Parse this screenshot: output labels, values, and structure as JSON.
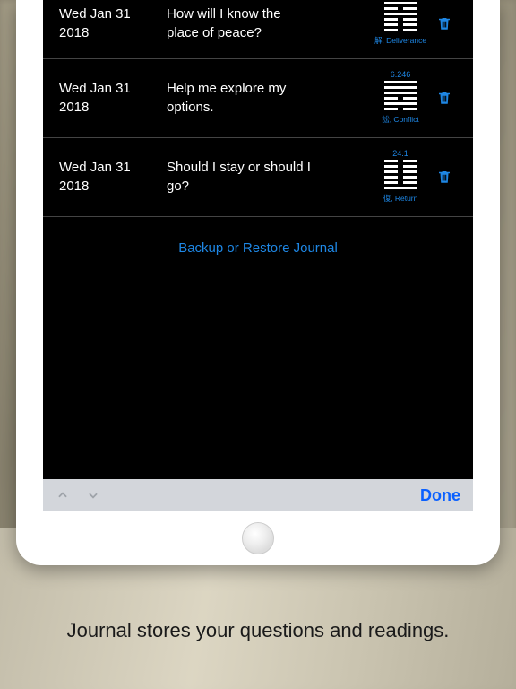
{
  "entries": [
    {
      "date_l1": "Wed Jan 31",
      "date_l2": "2018",
      "question_l1": "How will I know the",
      "question_l2": "place of peace?",
      "hex_num": "",
      "hex_name": "解, Deliverance",
      "pattern": [
        1,
        0,
        1,
        0,
        0,
        0
      ]
    },
    {
      "date_l1": "Wed Jan 31",
      "date_l2": "2018",
      "question_l1": "Help me explore my",
      "question_l2": "options.",
      "hex_num": "6.246",
      "hex_name": "訟, Conflict",
      "pattern": [
        1,
        1,
        1,
        0,
        1,
        0
      ]
    },
    {
      "date_l1": "Wed Jan 31",
      "date_l2": "2018",
      "question_l1": "Should I stay or should I",
      "question_l2": "go?",
      "hex_num": "24.1",
      "hex_name": "復, Return",
      "pattern": [
        0,
        0,
        0,
        0,
        0,
        1
      ]
    }
  ],
  "backup_label": "Backup or Restore Journal",
  "done_label": "Done",
  "caption": "Journal stores your questions and readings."
}
